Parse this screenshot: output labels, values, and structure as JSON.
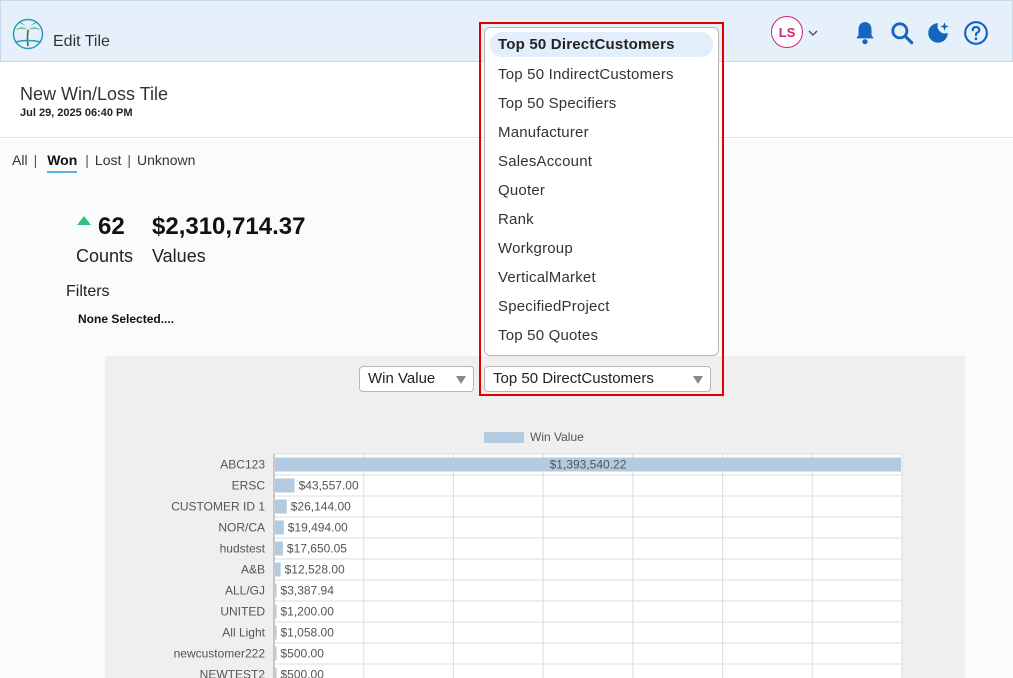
{
  "app": {
    "title": "Edit Tile"
  },
  "user": {
    "initials": "LS"
  },
  "tile": {
    "title": "New Win/Loss Tile",
    "date": "Jul 29, 2025 06:40 PM"
  },
  "tabs": [
    {
      "label": "All"
    },
    {
      "label": "Won"
    },
    {
      "label": "Lost"
    },
    {
      "label": "Unknown"
    }
  ],
  "active_tab": "Won",
  "summary": {
    "count": "62",
    "count_label": "Counts",
    "value": "$2,310,714.37",
    "value_label": "Values",
    "trend": "up"
  },
  "filters": {
    "label": "Filters",
    "value": "None Selected...."
  },
  "chart_controls": {
    "metric_select": "Win Value",
    "group_select": "Top 50 DirectCustomers"
  },
  "dropdown": {
    "options": [
      "Top 50 DirectCustomers",
      "Top 50 IndirectCustomers",
      "Top 50 Specifiers",
      "Manufacturer",
      "SalesAccount",
      "Quoter",
      "Rank",
      "Workgroup",
      "VerticalMarket",
      "SpecifiedProject",
      "Top 50 Quotes"
    ],
    "selected": "Top 50 DirectCustomers"
  },
  "colors": {
    "bar": "#b2cbe0",
    "accent": "#5ab0e8",
    "trend_up": "#2ec27e",
    "avatar": "#d1207a",
    "icon": "#1565c0",
    "highlight": "#e00000"
  },
  "chart_data": {
    "type": "bar",
    "orientation": "horizontal",
    "categories": [
      "ABC123",
      "ERSC",
      "CUSTOMER ID 1",
      "NOR/CA",
      "hudstest",
      "A&B",
      "ALL/GJ",
      "UNITED",
      "All Light",
      "newcustomer222",
      "NEWTEST2"
    ],
    "series": [
      {
        "name": "Win Value",
        "values": [
          1393540.22,
          43557.0,
          26144.0,
          19494.0,
          17650.05,
          12528.0,
          3387.94,
          1200.0,
          1058.0,
          500.0,
          500.0
        ]
      }
    ],
    "data_labels": [
      "$1,393,540.22",
      "$43,557.00",
      "$26,144.00",
      "$19,494.00",
      "$17,650.05",
      "$12,528.00",
      "$3,387.94",
      "$1,200.00",
      "$1,058.00",
      "$500.00",
      "$500.00"
    ],
    "xlim": [
      0,
      1400000
    ],
    "grid": true,
    "legend": "top"
  }
}
